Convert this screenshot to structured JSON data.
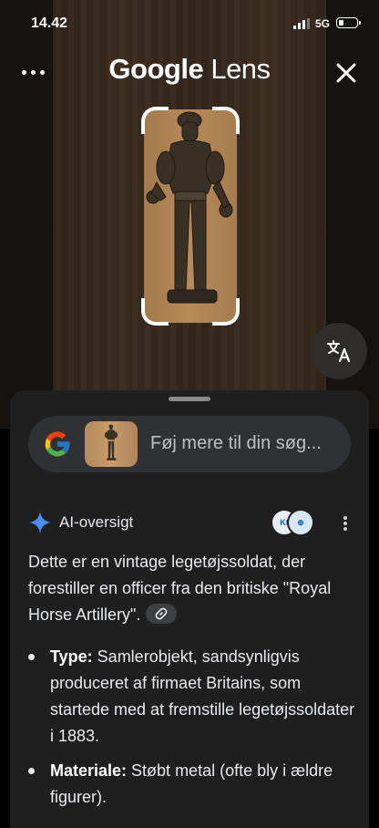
{
  "status_bar": {
    "time": "14.42",
    "network": "5G"
  },
  "header": {
    "title_brand": "Google",
    "title_product": "Lens",
    "menu_icon": "more-horizontal-icon",
    "close_icon": "close-icon"
  },
  "translate_button": {
    "icon": "translate-icon"
  },
  "search": {
    "placeholder": "Føj mere til din søg..."
  },
  "ai_overview": {
    "label": "AI-oversigt",
    "summary": "Dette er en vintage legetøjssoldat, der forestiller en officer fra den britiske \"Royal Horse Artillery\".",
    "bullets": [
      {
        "term": "Type:",
        "text": " Samlerobjekt, sandsynligvis produceret af firmaet Britains, som startede med at fremstille legetøjssoldater i 1883."
      },
      {
        "term": "Materiale:",
        "text": " Støbt metal (ofte bly i ældre figurer)."
      }
    ]
  },
  "colors": {
    "sheet_bg": "#1f1f1f",
    "search_bg": "#303134",
    "text": "#e8eaed",
    "ai_star": "#4a8cf5"
  }
}
